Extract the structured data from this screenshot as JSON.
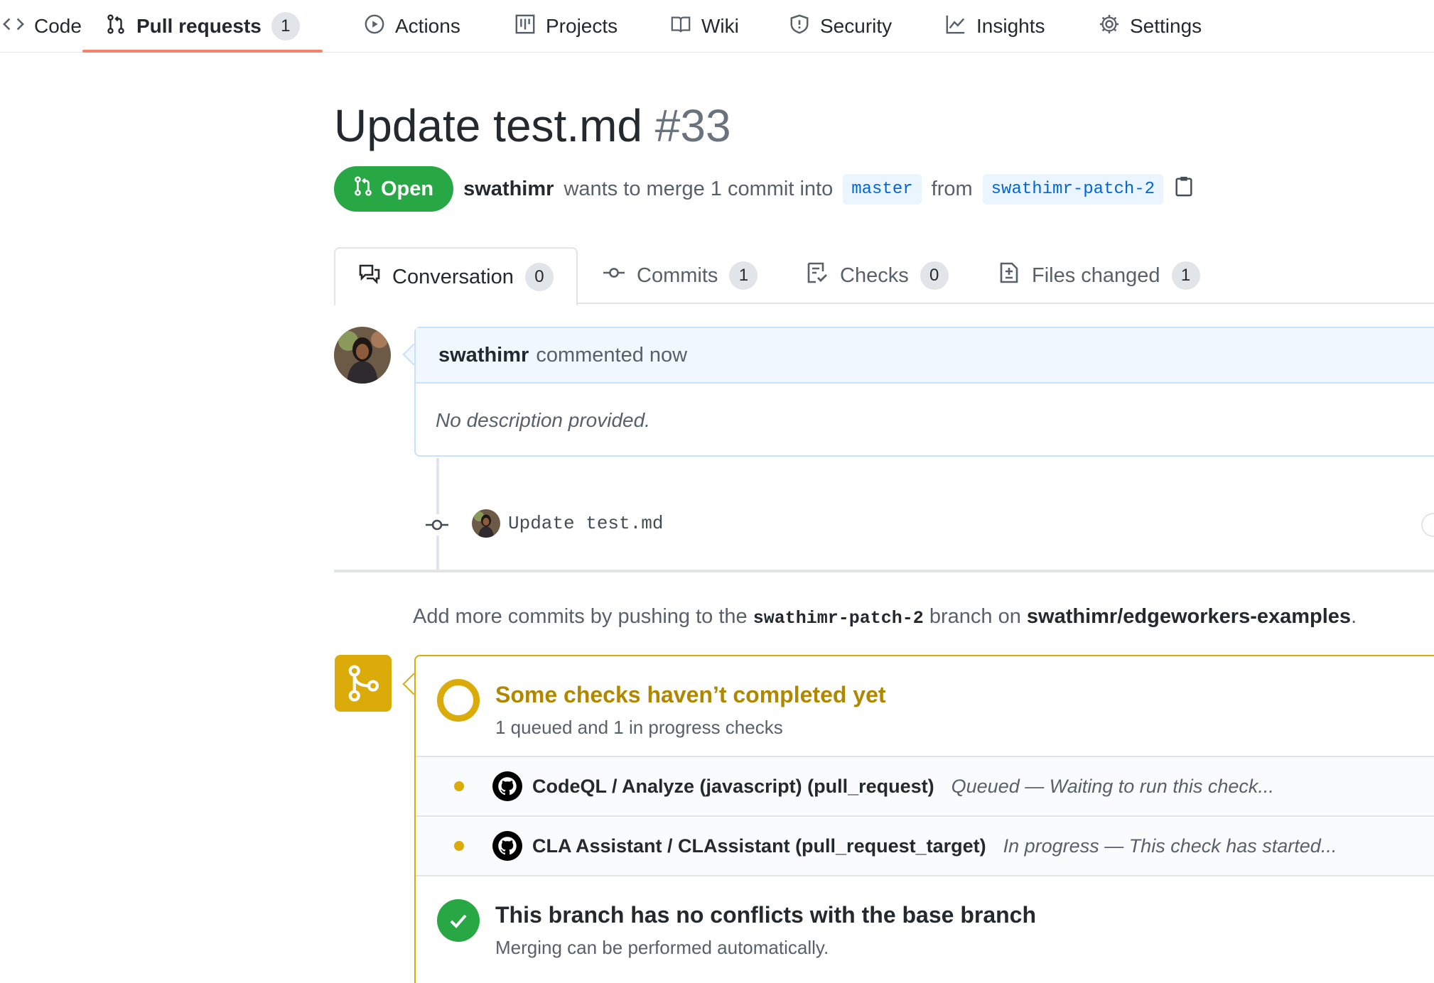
{
  "repo_nav": {
    "items": [
      {
        "label": "Code",
        "icon": "code-icon"
      },
      {
        "label": "Pull requests",
        "icon": "git-pull-request-icon",
        "count": "1",
        "selected": true
      },
      {
        "label": "Actions",
        "icon": "play-icon"
      },
      {
        "label": "Projects",
        "icon": "project-icon"
      },
      {
        "label": "Wiki",
        "icon": "book-icon"
      },
      {
        "label": "Security",
        "icon": "shield-icon"
      },
      {
        "label": "Insights",
        "icon": "graph-icon"
      },
      {
        "label": "Settings",
        "icon": "gear-icon"
      }
    ]
  },
  "pr": {
    "title": "Update test.md",
    "number": "#33",
    "state": "Open",
    "author": "swathimr",
    "merge_text": "wants to merge 1 commit into",
    "base_branch": "master",
    "from_text": "from",
    "head_branch": "swathimr-patch-2"
  },
  "tabs": [
    {
      "label": "Conversation",
      "count": "0",
      "icon": "comment-discussion-icon",
      "selected": true
    },
    {
      "label": "Commits",
      "count": "1",
      "icon": "git-commit-icon"
    },
    {
      "label": "Checks",
      "count": "0",
      "icon": "checklist-icon"
    },
    {
      "label": "Files changed",
      "count": "1",
      "icon": "file-diff-icon"
    }
  ],
  "comment": {
    "author": "swathimr",
    "action": "commented now",
    "body": "No description provided."
  },
  "commit": {
    "message": "Update test.md"
  },
  "push_hint": {
    "prefix": "Add more commits by pushing to the",
    "branch": "swathimr-patch-2",
    "middle": "branch on",
    "repo": "swathimr/edgeworkers-examples",
    "suffix": "."
  },
  "checks": {
    "title": "Some checks haven’t completed yet",
    "subtitle": "1 queued and 1 in progress checks",
    "items": [
      {
        "name": "CodeQL / Analyze (javascript) (pull_request)",
        "desc": "Queued — Waiting to run this check..."
      },
      {
        "name": "CLA Assistant / CLAssistant (pull_request_target)",
        "desc": "In progress — This check has started..."
      }
    ]
  },
  "conflicts": {
    "title": "This branch has no conflicts with the base branch",
    "subtitle": "Merging can be performed automatically."
  },
  "colors": {
    "open_green": "#28a745",
    "pending_yellow": "#dbab09",
    "link_blue": "#0366d6",
    "selected_underline": "#f9826c"
  }
}
